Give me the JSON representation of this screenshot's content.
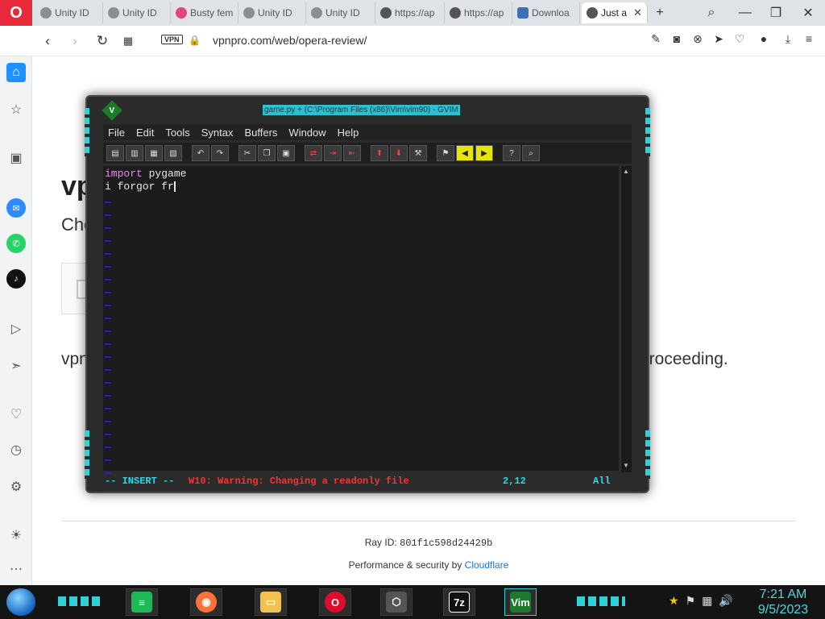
{
  "browser": {
    "tabs": [
      {
        "label": "Unity ID",
        "icon": "unity-icon"
      },
      {
        "label": "Unity ID",
        "icon": "unity-icon"
      },
      {
        "label": "Busty fem",
        "icon": "app-icon"
      },
      {
        "label": "Unity ID",
        "icon": "unity-icon"
      },
      {
        "label": "Unity ID",
        "icon": "unity-icon"
      },
      {
        "label": "https://ap",
        "icon": "globe-icon"
      },
      {
        "label": "https://ap",
        "icon": "globe-icon"
      },
      {
        "label": "Downloa",
        "icon": "download-site-icon"
      },
      {
        "label": "Just a",
        "icon": "globe-icon",
        "active": true
      }
    ],
    "new_tab": "+",
    "address": {
      "vpn": "VPN",
      "url": "vpnpro.com/web/opera-review/"
    }
  },
  "page": {
    "heading_partial": "vp",
    "subheading_partial": "Che",
    "body_left": "vpn",
    "body_right": "proceeding.",
    "ray_label": "Ray ID: ",
    "ray_id": "801f1c598d24429b",
    "perf_label": "Performance & security by ",
    "perf_link": "Cloudflare"
  },
  "vim": {
    "title": "game.py + (C:\\Program Files (x86)\\Vim\\vim90) - GVIM",
    "menu": [
      "File",
      "Edit",
      "Tools",
      "Syntax",
      "Buffers",
      "Window",
      "Help"
    ],
    "lines": [
      {
        "keyword": "import",
        "rest": " pygame"
      },
      {
        "keyword": "",
        "rest": "i forgor fr"
      }
    ],
    "status_mode": "-- INSERT --",
    "status_warning": "W10: Warning: Changing a readonly file",
    "status_position": "2,12",
    "status_scroll": "All"
  },
  "taskbar": {
    "apps": [
      "spotify-icon",
      "firefox-icon",
      "file-explorer-icon",
      "opera-icon",
      "unity-hub-icon",
      "7zip-icon",
      "vim-icon"
    ],
    "app_labels": {
      "7zip": "7z",
      "vim": "Vim"
    },
    "clock_time": "7:21 AM",
    "clock_date": "9/5/2023"
  }
}
